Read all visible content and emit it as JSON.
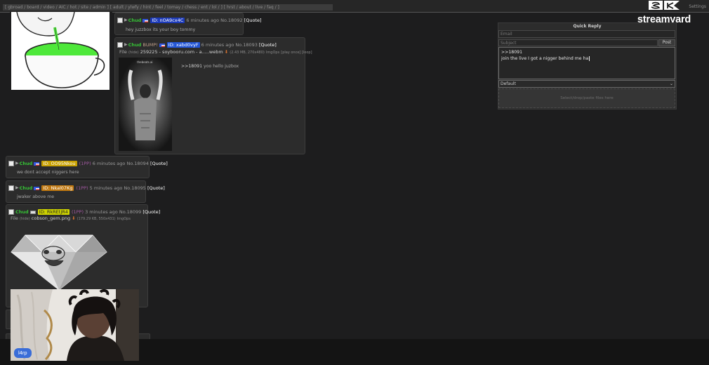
{
  "topbar": {
    "links": "[ gbroad / board / video / AIC / hot / site / admin ] [ adult / ylwfy / hint / feel / tomay / chess / ent / lol / ] [ hrst / about / live / faq / ]",
    "settings": "Settings"
  },
  "overlay": {
    "brand": "streamyard",
    "webcam_label": "l4rp"
  },
  "posts": [
    {
      "name": "Chud",
      "id": "ID: nOA9cx4C",
      "id_color": "#1c3ab8",
      "time": "6 minutes ago",
      "number": "No.18092",
      "quote": "[Quote]",
      "body": "hey juzzbox its your boy tommy"
    },
    {
      "name": "Chud",
      "trip": "BUMP!",
      "id": "ID: xabd0vyF",
      "id_color": "#2255d6",
      "time": "6 minutes ago",
      "number": "No.18093",
      "quote": "[Quote]",
      "file_label": "File",
      "file_hide": "(hide)",
      "file_name": "259225 - soybooru.com - a.....webm",
      "file_meta": "(2.43 MB, 270x480)",
      "file_extra": "ImgOps",
      "file_actions": "[play once] [loop]",
      "thumb_caption": "thebeats.ai",
      "body_quote": ">>18091",
      "body": "yoo hello juzbox"
    },
    {
      "name": "Chud",
      "id": "ID: OO95Nkou",
      "id_color": "#c8a000",
      "ppo": "(1PP)",
      "time": "6 minutes ago",
      "number": "No.18094",
      "quote": "[Quote]",
      "body": "we dont accept niggers here"
    },
    {
      "name": "Chud",
      "id": "ID: Nkal07Kg",
      "id_color": "#c07810",
      "ppo": "(1PP)",
      "time": "5 minutes ago",
      "number": "No.18095",
      "quote": "[Quote]",
      "body": "jwaker above me"
    },
    {
      "name": "Chud",
      "id": "ID: RkREtJR4",
      "id_color": "#cfd400",
      "ppo": "(1PP)",
      "time": "3 minutes ago",
      "number": "No.18099",
      "quote": "[Quote]",
      "file_label": "File",
      "file_hide": "(hide)",
      "file_name": "cobson_gem.png",
      "file_meta": "(179.29 KB, 550x431)",
      "file_extra": "ImgOps"
    }
  ],
  "quick_reply": {
    "title": "Quick Reply",
    "email_placeholder": "Email",
    "subject_placeholder": "Subject",
    "post_label": "Post",
    "comment_line1": ">>18091",
    "comment_line2": "join the live I got a nigger behind me ha",
    "select_value": "Default",
    "drop_text": "Select/drop/paste files here"
  }
}
